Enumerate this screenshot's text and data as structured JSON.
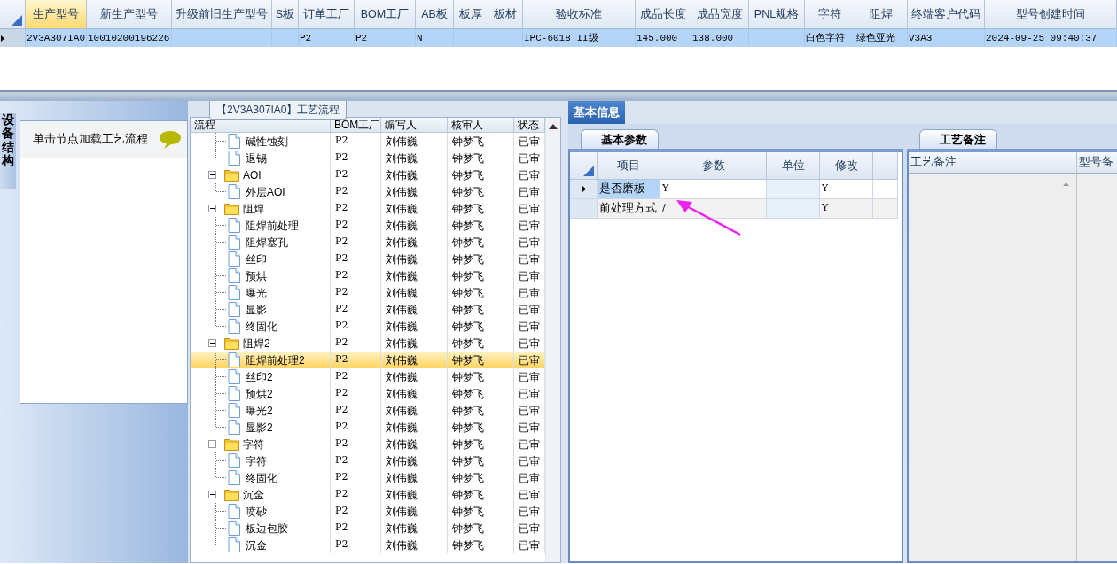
{
  "top_grid": {
    "columns": [
      {
        "label": "生产型号",
        "selected": true
      },
      {
        "label": "新生产型号",
        "selected": false
      },
      {
        "label": "升级前旧生产型号",
        "selected": false
      },
      {
        "label": "S板",
        "selected": false
      },
      {
        "label": "订单工厂",
        "selected": false
      },
      {
        "label": "BOM工厂",
        "selected": false
      },
      {
        "label": "AB板",
        "selected": false
      },
      {
        "label": "板厚",
        "selected": false
      },
      {
        "label": "板材",
        "selected": false
      },
      {
        "label": "验收标准",
        "selected": false
      },
      {
        "label": "成品长度",
        "selected": false
      },
      {
        "label": "成品宽度",
        "selected": false
      },
      {
        "label": "PNL规格",
        "selected": false
      },
      {
        "label": "字符",
        "selected": false
      },
      {
        "label": "阻焊",
        "selected": false
      },
      {
        "label": "终端客户代码",
        "selected": false
      },
      {
        "label": "型号创建时间",
        "selected": false
      }
    ],
    "rows": [
      {
        "selected": true,
        "cells": [
          "2V3A307IA0",
          "10010200196226",
          null,
          null,
          "P2",
          "P2",
          "N",
          null,
          null,
          "IPC-6018 II级",
          "145.000",
          "138.000",
          null,
          "白色字符",
          "绿色亚光",
          "V3A3",
          "2024-09-25 09:40:37"
        ]
      }
    ]
  },
  "side_tab": {
    "label": "设备结构"
  },
  "side_panel": {
    "hint": "单击节点加载工艺流程"
  },
  "flow": {
    "title": "【2V3A307IA0】工艺流程",
    "columns": [
      "流程",
      "BOM工厂",
      "编写人",
      "核审人",
      "状态"
    ],
    "nodes": [
      {
        "kind": "step",
        "label": "碱性蚀刻",
        "factory": "P2",
        "writer": "刘伟巍",
        "reviewer": "钟梦飞",
        "status": "已审",
        "selected": false
      },
      {
        "kind": "step",
        "label": "退锡",
        "factory": "P2",
        "writer": "刘伟巍",
        "reviewer": "钟梦飞",
        "status": "已审",
        "selected": false
      },
      {
        "kind": "group",
        "label": "AOI",
        "factory": "P2",
        "writer": "刘伟巍",
        "reviewer": "钟梦飞",
        "status": "已审",
        "selected": false,
        "expanded": true,
        "children": [
          {
            "kind": "step",
            "label": "外层AOI",
            "factory": "P2",
            "writer": "刘伟巍",
            "reviewer": "钟梦飞",
            "status": "已审",
            "selected": false
          }
        ]
      },
      {
        "kind": "group",
        "label": "阻焊",
        "factory": "P2",
        "writer": "刘伟巍",
        "reviewer": "钟梦飞",
        "status": "已审",
        "selected": false,
        "expanded": true,
        "children": [
          {
            "kind": "step",
            "label": "阻焊前处理",
            "factory": "P2",
            "writer": "刘伟巍",
            "reviewer": "钟梦飞",
            "status": "已审",
            "selected": false
          },
          {
            "kind": "step",
            "label": "阻焊塞孔",
            "factory": "P2",
            "writer": "刘伟巍",
            "reviewer": "钟梦飞",
            "status": "已审",
            "selected": false
          },
          {
            "kind": "step",
            "label": "丝印",
            "factory": "P2",
            "writer": "刘伟巍",
            "reviewer": "钟梦飞",
            "status": "已审",
            "selected": false
          },
          {
            "kind": "step",
            "label": "预烘",
            "factory": "P2",
            "writer": "刘伟巍",
            "reviewer": "钟梦飞",
            "status": "已审",
            "selected": false
          },
          {
            "kind": "step",
            "label": "曝光",
            "factory": "P2",
            "writer": "刘伟巍",
            "reviewer": "钟梦飞",
            "status": "已审",
            "selected": false
          },
          {
            "kind": "step",
            "label": "显影",
            "factory": "P2",
            "writer": "刘伟巍",
            "reviewer": "钟梦飞",
            "status": "已审",
            "selected": false
          },
          {
            "kind": "step",
            "label": "终固化",
            "factory": "P2",
            "writer": "刘伟巍",
            "reviewer": "钟梦飞",
            "status": "已审",
            "selected": false
          }
        ]
      },
      {
        "kind": "group",
        "label": "阻焊2",
        "factory": "P2",
        "writer": "刘伟巍",
        "reviewer": "钟梦飞",
        "status": "已审",
        "selected": false,
        "expanded": true,
        "children": [
          {
            "kind": "step",
            "label": "阻焊前处理2",
            "factory": "P2",
            "writer": "刘伟巍",
            "reviewer": "钟梦飞",
            "status": "已审",
            "selected": true
          },
          {
            "kind": "step",
            "label": "丝印2",
            "factory": "P2",
            "writer": "刘伟巍",
            "reviewer": "钟梦飞",
            "status": "已审",
            "selected": false
          },
          {
            "kind": "step",
            "label": "预烘2",
            "factory": "P2",
            "writer": "刘伟巍",
            "reviewer": "钟梦飞",
            "status": "已审",
            "selected": false
          },
          {
            "kind": "step",
            "label": "曝光2",
            "factory": "P2",
            "writer": "刘伟巍",
            "reviewer": "钟梦飞",
            "status": "已审",
            "selected": false
          },
          {
            "kind": "step",
            "label": "显影2",
            "factory": "P2",
            "writer": "刘伟巍",
            "reviewer": "钟梦飞",
            "status": "已审",
            "selected": false
          }
        ]
      },
      {
        "kind": "group",
        "label": "字符",
        "factory": "P2",
        "writer": "刘伟巍",
        "reviewer": "钟梦飞",
        "status": "已审",
        "selected": false,
        "expanded": true,
        "children": [
          {
            "kind": "step",
            "label": "字符",
            "factory": "P2",
            "writer": "刘伟巍",
            "reviewer": "钟梦飞",
            "status": "已审",
            "selected": false
          },
          {
            "kind": "step",
            "label": "终固化",
            "factory": "P2",
            "writer": "刘伟巍",
            "reviewer": "钟梦飞",
            "status": "已审",
            "selected": false
          }
        ]
      },
      {
        "kind": "group",
        "label": "沉金",
        "factory": "P2",
        "writer": "刘伟巍",
        "reviewer": "钟梦飞",
        "status": "已审",
        "selected": false,
        "expanded": true,
        "children": [
          {
            "kind": "step",
            "label": "喷砂",
            "factory": "P2",
            "writer": "刘伟巍",
            "reviewer": "钟梦飞",
            "status": "已审",
            "selected": false
          },
          {
            "kind": "step",
            "label": "板边包胶",
            "factory": "P2",
            "writer": "刘伟巍",
            "reviewer": "钟梦飞",
            "status": "已审",
            "selected": false
          },
          {
            "kind": "step",
            "label": "沉金",
            "factory": "P2",
            "writer": "刘伟巍",
            "reviewer": "钟梦飞",
            "status": "已审",
            "selected": false
          }
        ]
      }
    ]
  },
  "info_tabs": [
    {
      "label": "基本信息",
      "selected": true
    }
  ],
  "params": {
    "tab": {
      "label": "基本参数",
      "selected": true
    },
    "columns": [
      "项目",
      "参数",
      "单位",
      "修改"
    ],
    "rows": [
      {
        "selected": true,
        "item": "是否磨板",
        "value": "Y",
        "changed": "Y"
      },
      {
        "selected": false,
        "item": "前处理方式",
        "value": "/",
        "changed": "Y"
      }
    ]
  },
  "notes": {
    "tab": {
      "label": "工艺备注",
      "selected": true
    },
    "columns": [
      "工艺备注",
      "型号备"
    ]
  }
}
